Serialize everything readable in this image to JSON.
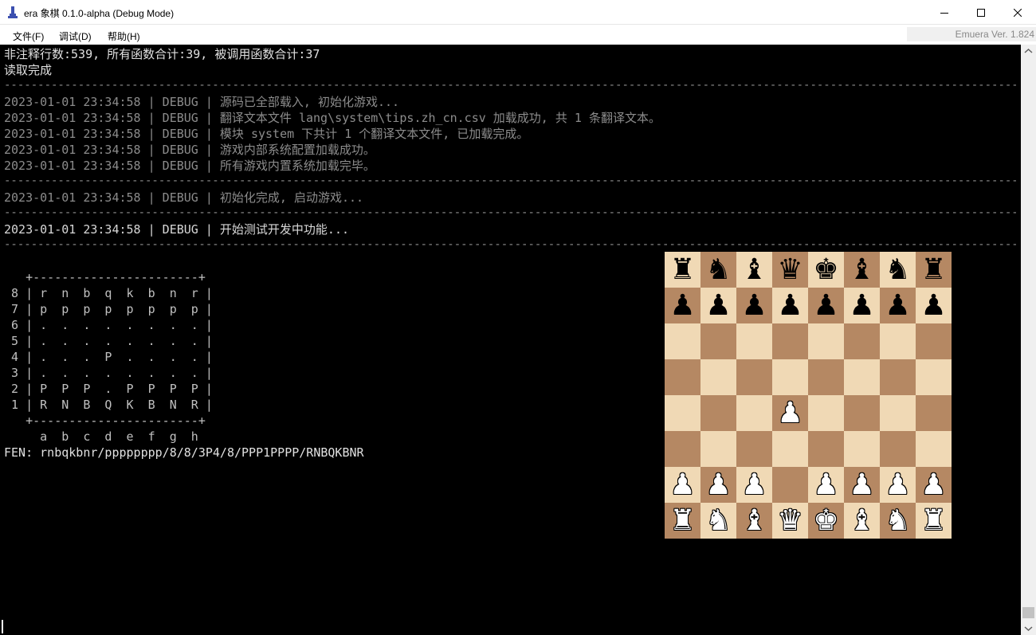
{
  "window": {
    "title": "era 象棋 0.1.0-alpha (Debug Mode)",
    "version": "Emuera Ver. 1.824"
  },
  "menu": [
    "文件(F)",
    "调试(D)",
    "帮助(H)"
  ],
  "console": {
    "stats": "非注释行数:539, 所有函数合计:39, 被调用函数合计:37",
    "loaded": "读取完成",
    "rule": "--------------------------------------------------------------------------------------------------------------------------------------------------------------------",
    "logs1": [
      "2023-01-01 23:34:58 | DEBUG | 源码已全部载入, 初始化游戏...",
      "2023-01-01 23:34:58 | DEBUG | 翻译文本文件 lang\\system\\tips.zh_cn.csv 加载成功, 共 1 条翻译文本。",
      "2023-01-01 23:34:58 | DEBUG | 模块 system 下共计 1 个翻译文本文件, 已加载完成。",
      "2023-01-01 23:34:58 | DEBUG | 游戏内部系统配置加载成功。",
      "2023-01-01 23:34:58 | DEBUG | 所有游戏内置系统加载完毕。"
    ],
    "log2": "2023-01-01 23:34:58 | DEBUG | 初始化完成, 启动游戏...",
    "log3": "2023-01-01 23:34:58 | DEBUG | 开始测试开发中功能...",
    "ascii_board": [
      "   +-----------------------+",
      " 8 | r  n  b  q  k  b  n  r |",
      " 7 | p  p  p  p  p  p  p  p |",
      " 6 | .  .  .  .  .  .  .  . |",
      " 5 | .  .  .  .  .  .  .  . |",
      " 4 | .  .  .  P  .  .  .  . |",
      " 3 | .  .  .  .  .  .  .  . |",
      " 2 | P  P  P  .  P  P  P  P |",
      " 1 | R  N  B  Q  K  B  N  R |",
      "   +-----------------------+",
      "",
      "     a  b  c  d  e  f  g  h"
    ],
    "fen": "FEN: rnbqkbnr/pppppppp/8/8/3P4/8/PPP1PPPP/RNBQKBNR"
  },
  "board": {
    "light_color": "#f0d9b5",
    "dark_color": "#b58863",
    "rows": [
      [
        "r",
        "n",
        "b",
        "q",
        "k",
        "b",
        "n",
        "r"
      ],
      [
        "p",
        "p",
        "p",
        "p",
        "p",
        "p",
        "p",
        "p"
      ],
      [
        "",
        "",
        "",
        "",
        "",
        "",
        "",
        ""
      ],
      [
        "",
        "",
        "",
        "",
        "",
        "",
        "",
        ""
      ],
      [
        "",
        "",
        "",
        "P",
        "",
        "",
        "",
        ""
      ],
      [
        "",
        "",
        "",
        "",
        "",
        "",
        "",
        ""
      ],
      [
        "P",
        "P",
        "P",
        "",
        "P",
        "P",
        "P",
        "P"
      ],
      [
        "R",
        "N",
        "B",
        "Q",
        "K",
        "B",
        "N",
        "R"
      ]
    ]
  }
}
